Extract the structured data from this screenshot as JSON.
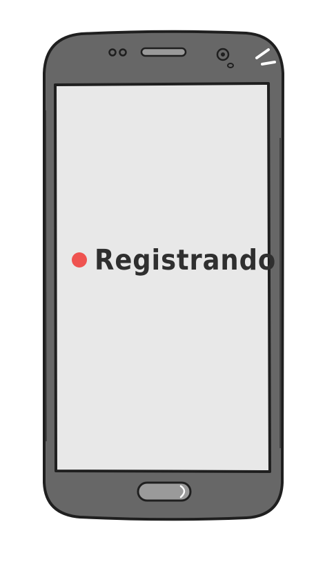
{
  "screen": {
    "status_label": "Registrando",
    "indicator": "recording-dot-icon"
  },
  "colors": {
    "phone_body": "#676767",
    "phone_outline": "#1f1f1f",
    "screen_bg": "#e8e8e8",
    "recording_dot": "#ef5350",
    "text": "#2f2f2f",
    "home_button": "#9a9a9a"
  }
}
